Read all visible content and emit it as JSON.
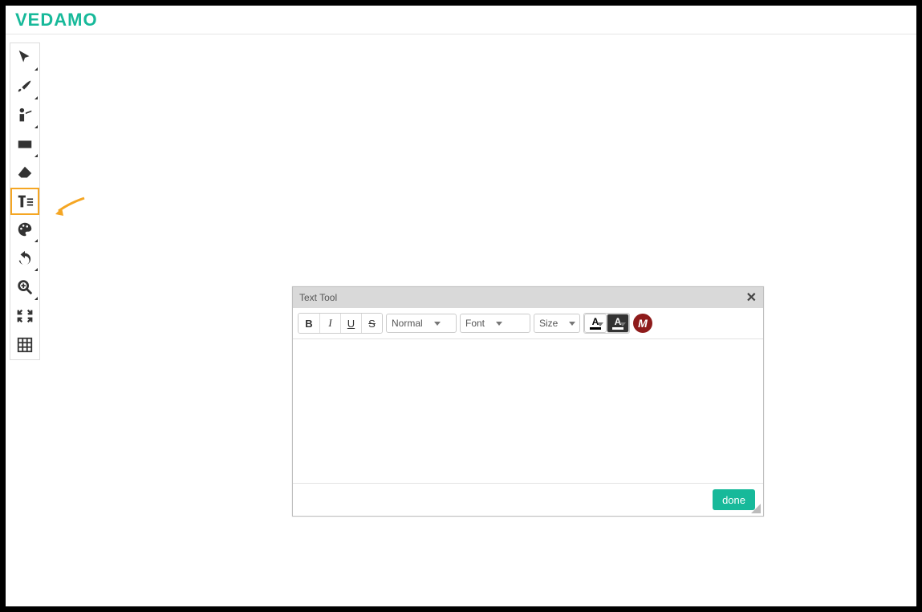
{
  "brand": {
    "name": "VEDAMO"
  },
  "toolbar": {
    "tools": [
      {
        "id": "pointer",
        "icon": "pointer"
      },
      {
        "id": "brush",
        "icon": "brush"
      },
      {
        "id": "presenter",
        "icon": "presenter"
      },
      {
        "id": "shape",
        "icon": "shape"
      },
      {
        "id": "eraser",
        "icon": "eraser"
      },
      {
        "id": "text",
        "icon": "text",
        "selected": true
      },
      {
        "id": "palette",
        "icon": "palette"
      },
      {
        "id": "undo",
        "icon": "undo"
      },
      {
        "id": "zoom",
        "icon": "zoom"
      },
      {
        "id": "fit",
        "icon": "fit"
      },
      {
        "id": "grid",
        "icon": "grid"
      }
    ]
  },
  "dialog": {
    "title": "Text Tool",
    "buttons": {
      "bold_label": "B",
      "italic_label": "I",
      "underline_label": "U",
      "strike_label": "S",
      "text_color_glyph": "A",
      "bg_color_glyph": "A",
      "math_glyph": "M"
    },
    "selects": {
      "format_label": "Normal",
      "font_label": "Font",
      "size_label": "Size"
    },
    "done_label": "done",
    "content": ""
  },
  "colors": {
    "accent": "#17b99a",
    "highlight": "#f5a623"
  }
}
